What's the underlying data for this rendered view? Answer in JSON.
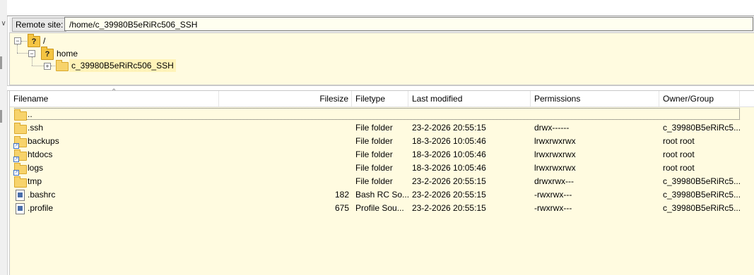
{
  "remote_bar": {
    "label": "Remote site:",
    "path": "/home/c_39980B5eRiRc506_SSH"
  },
  "tree": {
    "root": {
      "icon": "unknown-folder-icon",
      "label": "/"
    },
    "home": {
      "icon": "unknown-folder-icon",
      "label": "home"
    },
    "user": {
      "icon": "folder-icon",
      "label": "c_39980B5eRiRc506_SSH"
    }
  },
  "list": {
    "columns": {
      "filename": "Filename",
      "filesize": "Filesize",
      "filetype": "Filetype",
      "modified": "Last modified",
      "permissions": "Permissions",
      "owner": "Owner/Group"
    },
    "rows": [
      {
        "name": "..",
        "icon": "folder-icon",
        "size": "",
        "type": "",
        "modified": "",
        "perms": "",
        "owner": ""
      },
      {
        "name": ".ssh",
        "icon": "folder-icon",
        "size": "",
        "type": "File folder",
        "modified": "23-2-2026 20:55:15",
        "perms": "drwx------",
        "owner": "c_39980B5eRiRc5..."
      },
      {
        "name": "backups",
        "icon": "folder-link-icon",
        "size": "",
        "type": "File folder",
        "modified": "18-3-2026 10:05:46",
        "perms": "lrwxrwxrwx",
        "owner": "root root"
      },
      {
        "name": "htdocs",
        "icon": "folder-link-icon",
        "size": "",
        "type": "File folder",
        "modified": "18-3-2026 10:05:46",
        "perms": "lrwxrwxrwx",
        "owner": "root root"
      },
      {
        "name": "logs",
        "icon": "folder-link-icon",
        "size": "",
        "type": "File folder",
        "modified": "18-3-2026 10:05:46",
        "perms": "lrwxrwxrwx",
        "owner": "root root"
      },
      {
        "name": "tmp",
        "icon": "folder-icon",
        "size": "",
        "type": "File folder",
        "modified": "23-2-2026 20:55:15",
        "perms": "drwxrwx---",
        "owner": "c_39980B5eRiRc5..."
      },
      {
        "name": ".bashrc",
        "icon": "file-icon",
        "size": "182",
        "type": "Bash RC So...",
        "modified": "23-2-2026 20:55:15",
        "perms": "-rwxrwx---",
        "owner": "c_39980B5eRiRc5..."
      },
      {
        "name": ".profile",
        "icon": "file-icon",
        "size": "675",
        "type": "Profile Sou...",
        "modified": "23-2-2026 20:55:15",
        "perms": "-rwxrwx---",
        "owner": "c_39980B5eRiRc5..."
      }
    ]
  }
}
